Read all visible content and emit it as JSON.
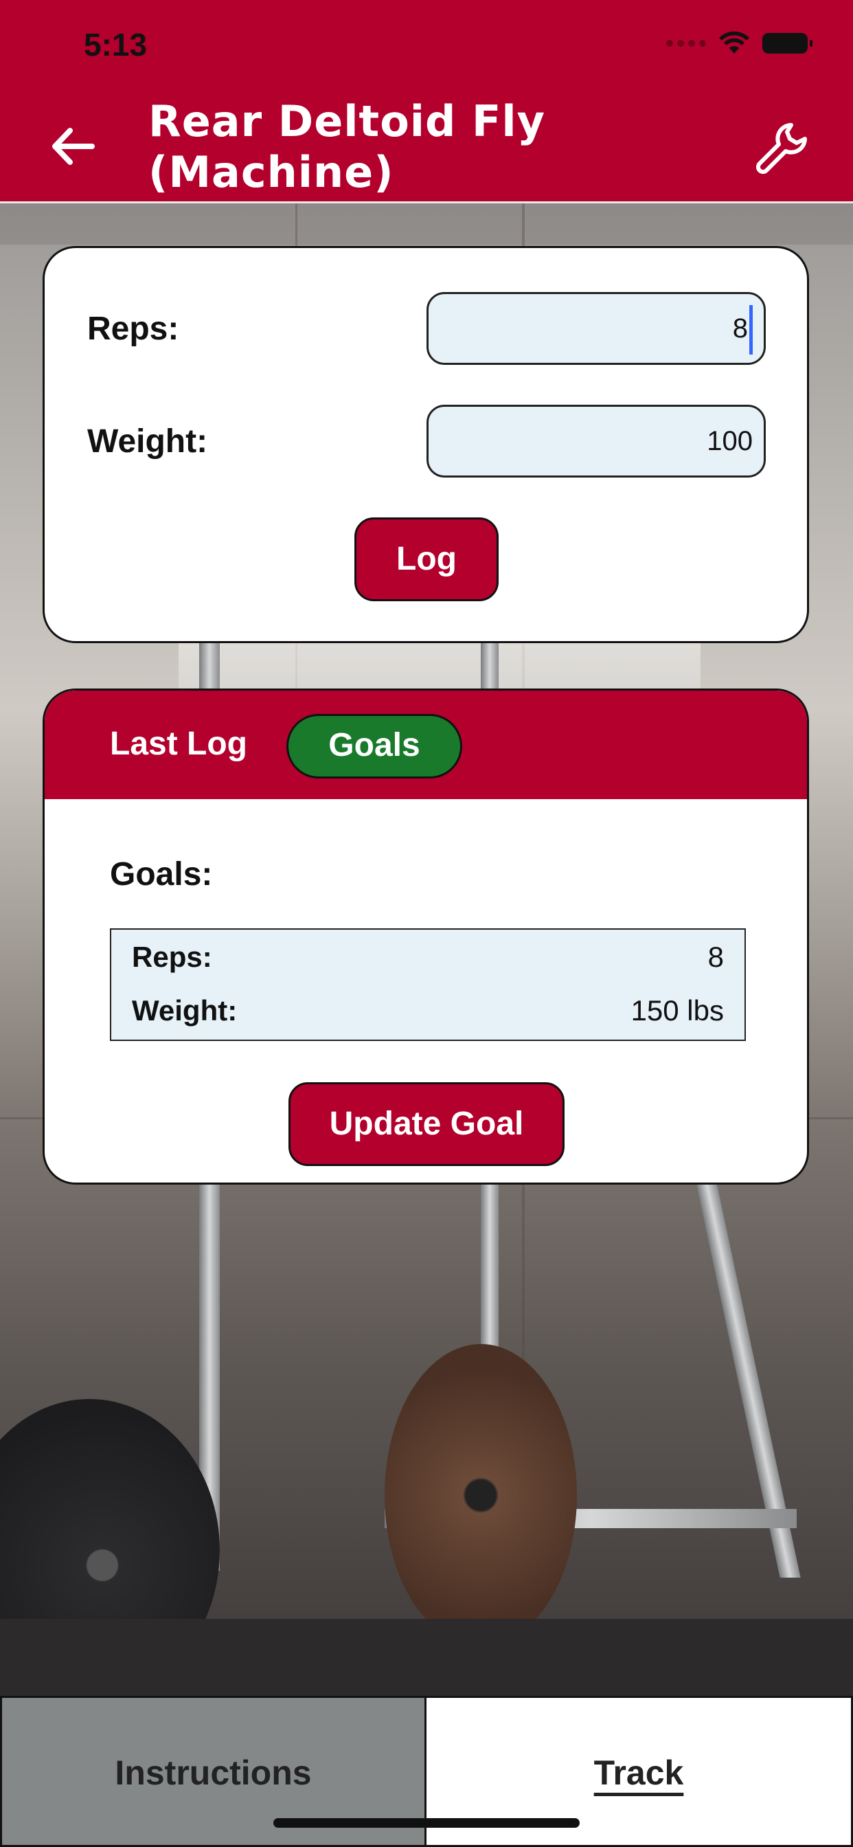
{
  "status_bar": {
    "time": "5:13"
  },
  "header": {
    "title_line1": "Rear Deltoid Fly",
    "title_line2": "(Machine)",
    "back_icon": "arrow-left-icon",
    "settings_icon": "wrench-icon"
  },
  "log_form": {
    "reps_label": "Reps:",
    "reps_value": "8",
    "weight_label": "Weight:",
    "weight_value": "100",
    "log_button": "Log"
  },
  "goals_panel": {
    "tabs": [
      "Last Log",
      "Goals"
    ],
    "active_tab": "Goals",
    "section_title": "Goals:",
    "rows": [
      {
        "label": "Reps:",
        "value": "8"
      },
      {
        "label": "Weight:",
        "value": "150 lbs"
      }
    ],
    "update_button": "Update Goal"
  },
  "bottom_tabs": {
    "instructions": "Instructions",
    "track": "Track",
    "active": "Track"
  },
  "colors": {
    "brand_red": "#b3002d",
    "active_tab_green": "#1a7a2c",
    "input_bg": "#e6f1f8",
    "inactive_tab_gray": "#858888"
  }
}
